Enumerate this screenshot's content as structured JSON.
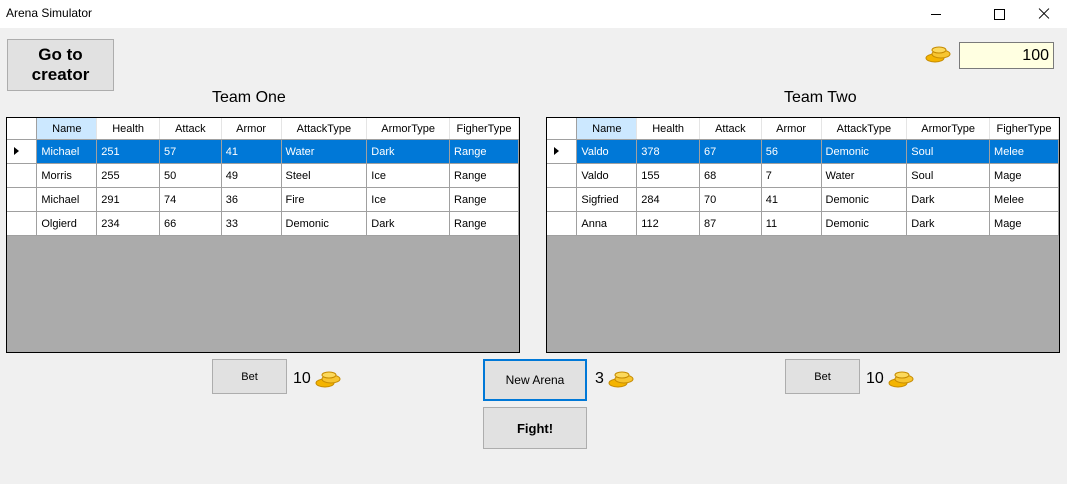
{
  "window": {
    "title": "Arena Simulator"
  },
  "buttons": {
    "creator": "Go to creator",
    "bet": "Bet",
    "new_arena": "New Arena",
    "fight": "Fight!"
  },
  "gold": {
    "value": "100",
    "icon": "gold-coins-icon",
    "color": "#f4b400"
  },
  "team_one": {
    "title": "Team One",
    "columns": [
      "Name",
      "Health",
      "Attack",
      "Armor",
      "AttackType",
      "ArmorType",
      "FigherType"
    ],
    "rows": [
      [
        "Michael",
        "251",
        "57",
        "41",
        "Water",
        "Dark",
        "Range"
      ],
      [
        "Morris",
        "255",
        "50",
        "49",
        "Steel",
        "Ice",
        "Range"
      ],
      [
        "Michael",
        "291",
        "74",
        "36",
        "Fire",
        "Ice",
        "Range"
      ],
      [
        "Olgierd",
        "234",
        "66",
        "33",
        "Demonic",
        "Dark",
        "Range"
      ]
    ],
    "bet_amount": "10"
  },
  "team_two": {
    "title": "Team Two",
    "columns": [
      "Name",
      "Health",
      "Attack",
      "Armor",
      "AttackType",
      "ArmorType",
      "FigherType"
    ],
    "rows": [
      [
        "Valdo",
        "378",
        "67",
        "56",
        "Demonic",
        "Soul",
        "Melee"
      ],
      [
        "Valdo",
        "155",
        "68",
        "7",
        "Water",
        "Soul",
        "Mage"
      ],
      [
        "Sigfried",
        "284",
        "70",
        "41",
        "Demonic",
        "Dark",
        "Melee"
      ],
      [
        "Anna",
        "112",
        "87",
        "11",
        "Demonic",
        "Dark",
        "Mage"
      ]
    ],
    "bet_amount": "10"
  },
  "arena": {
    "cost": "3"
  },
  "colors": {
    "selection": "#0078d7",
    "grid_background": "#ababab"
  }
}
